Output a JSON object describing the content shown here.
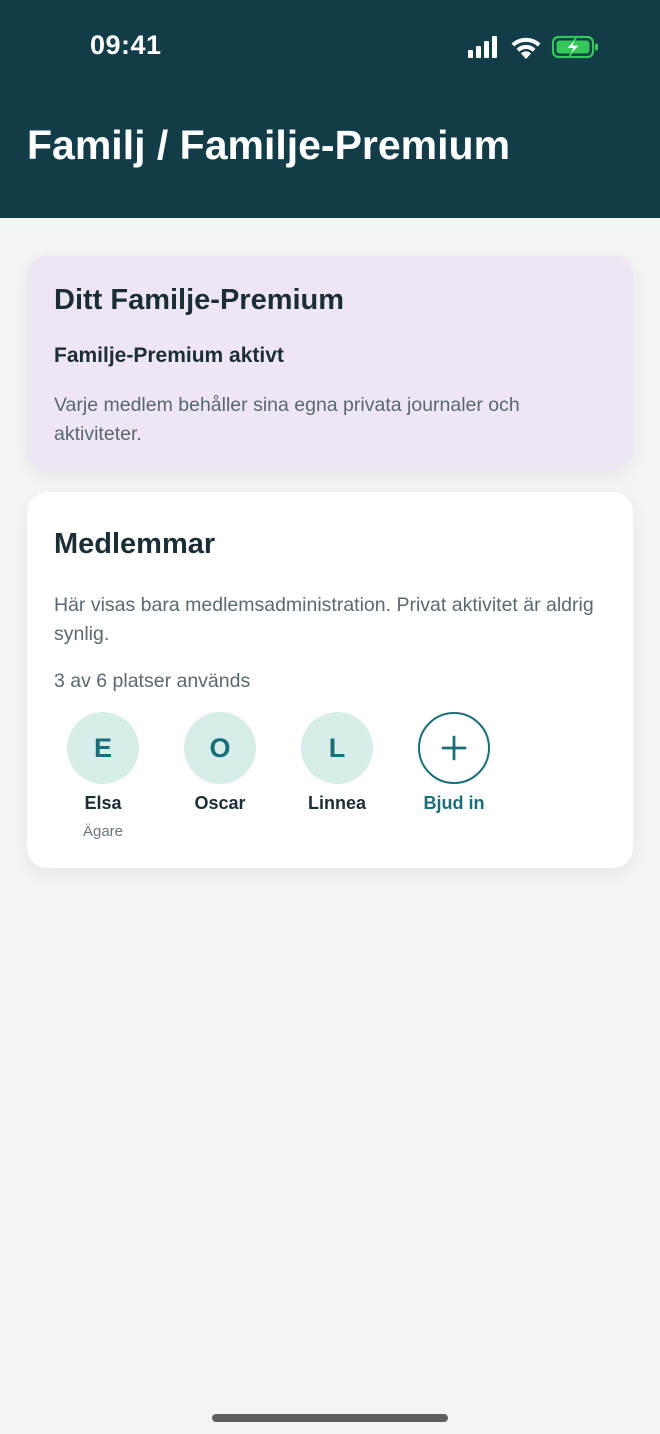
{
  "status_bar": {
    "time": "09:41",
    "icons": [
      "cellular-signal-icon",
      "wifi-icon",
      "battery-charging-icon"
    ]
  },
  "header": {
    "title": "Familj / Familje-Premium"
  },
  "premium_card": {
    "title": "Ditt Familje-Premium",
    "status": "Familje-Premium aktivt",
    "description": "Varje medlem behåller sina egna privata journaler och aktiviteter."
  },
  "members_card": {
    "title": "Medlemmar",
    "description": "Här visas bara medlemsadministration. Privat aktivitet är aldrig synlig.",
    "seats": "3 av 6 platser används",
    "members": [
      {
        "initial": "E",
        "name": "Elsa",
        "role": "Ägare"
      },
      {
        "initial": "O",
        "name": "Oscar",
        "role": ""
      },
      {
        "initial": "L",
        "name": "Linnea",
        "role": ""
      }
    ],
    "invite": {
      "icon": "plus-icon",
      "label": "Bjud in"
    }
  },
  "colors": {
    "header_bg": "#123C48",
    "accent": "#1A6E78",
    "premium_card_bg": "#EEE7F3",
    "avatar_bg": "#D6EDEA",
    "battery_green": "#34C759"
  }
}
